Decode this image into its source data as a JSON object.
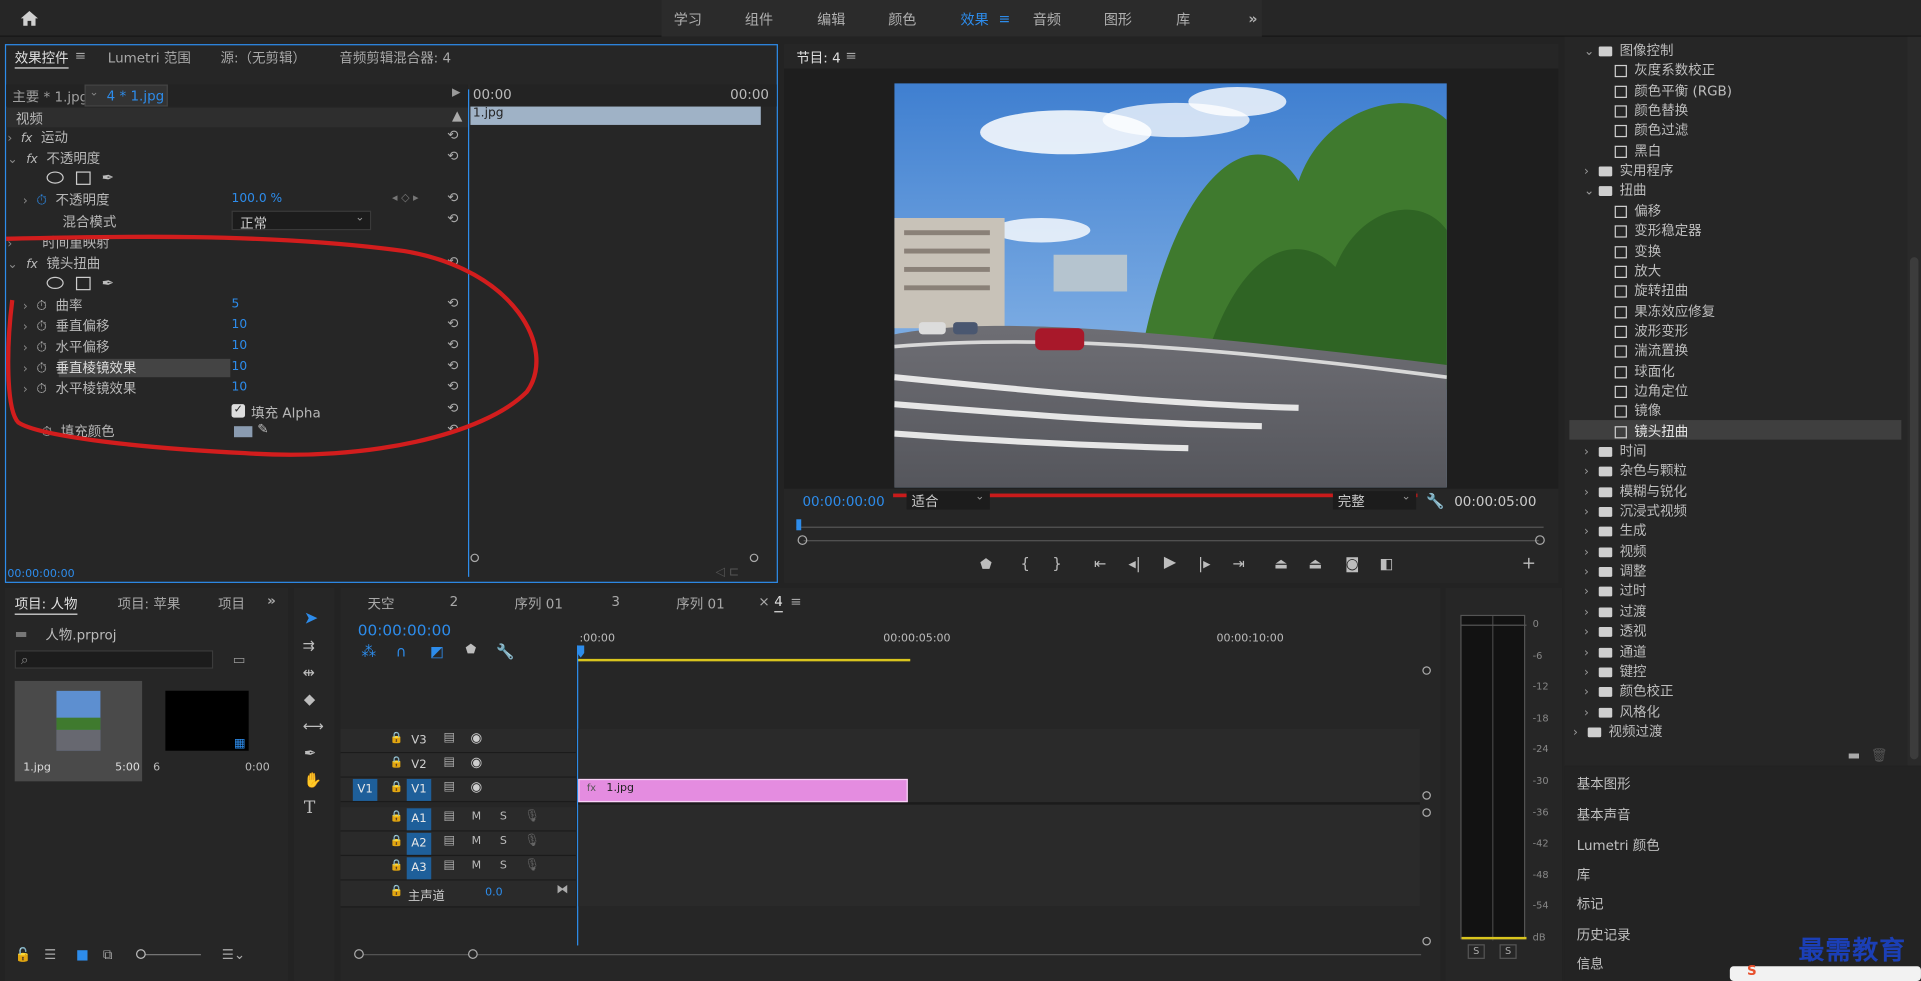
{
  "workspace": {
    "home": "home-icon",
    "tabs": [
      "学习",
      "组件",
      "编辑",
      "颜色",
      "效果",
      "音频",
      "图形",
      "库"
    ],
    "active": "效果",
    "more": "»"
  },
  "effect_controls": {
    "tabs": [
      "效果控件",
      "Lumetri 范围",
      "源:（无剪辑）",
      "音频剪辑混合器: 4"
    ],
    "master": "主要 * 1.jpg",
    "clip": "4 * 1.jpg",
    "time_start": "00:00",
    "time_end": "00:00",
    "clip_name": "1.jpg",
    "video_heading": "视频",
    "motion": "运动",
    "opacity": "不透明度",
    "opacity_prop": "不透明度",
    "opacity_value": "100.0 %",
    "blend_mode": "混合模式",
    "blend_value": "正常",
    "time_remap": "时间重映射",
    "lens_distortion": "镜头扭曲",
    "params": [
      {
        "label": "曲率",
        "value": "5"
      },
      {
        "label": "垂直偏移",
        "value": "10"
      },
      {
        "label": "水平偏移",
        "value": "10"
      },
      {
        "label": "垂直棱镜效果",
        "value": "10"
      },
      {
        "label": "水平棱镜效果",
        "value": "10"
      }
    ],
    "fill_alpha": "填充 Alpha",
    "fill_color": "填充颜色",
    "timecode": "00:00:00:00"
  },
  "program": {
    "title": "节目: 4",
    "timecode": "00:00:00:00",
    "fit": "适合",
    "quality": "完整",
    "duration": "00:00:05:00"
  },
  "effects_tree": [
    {
      "label": "图像控制",
      "type": "folder",
      "indent": 1,
      "open": true
    },
    {
      "label": "灰度系数校正",
      "type": "effect",
      "indent": 2
    },
    {
      "label": "颜色平衡 (RGB)",
      "type": "effect",
      "indent": 2
    },
    {
      "label": "颜色替换",
      "type": "effect",
      "indent": 2
    },
    {
      "label": "颜色过滤",
      "type": "effect",
      "indent": 2
    },
    {
      "label": "黑白",
      "type": "effect",
      "indent": 2
    },
    {
      "label": "实用程序",
      "type": "folder",
      "indent": 1,
      "open": false
    },
    {
      "label": "扭曲",
      "type": "folder",
      "indent": 1,
      "open": true
    },
    {
      "label": "偏移",
      "type": "effect",
      "indent": 2
    },
    {
      "label": "变形稳定器",
      "type": "effect",
      "indent": 2
    },
    {
      "label": "变换",
      "type": "effect",
      "indent": 2
    },
    {
      "label": "放大",
      "type": "effect",
      "indent": 2
    },
    {
      "label": "旋转扭曲",
      "type": "effect",
      "indent": 2
    },
    {
      "label": "果冻效应修复",
      "type": "effect",
      "indent": 2
    },
    {
      "label": "波形变形",
      "type": "effect",
      "indent": 2
    },
    {
      "label": "湍流置换",
      "type": "effect",
      "indent": 2
    },
    {
      "label": "球面化",
      "type": "effect",
      "indent": 2
    },
    {
      "label": "边角定位",
      "type": "effect",
      "indent": 2
    },
    {
      "label": "镜像",
      "type": "effect",
      "indent": 2
    },
    {
      "label": "镜头扭曲",
      "type": "effect",
      "indent": 2,
      "selected": true
    },
    {
      "label": "时间",
      "type": "folder",
      "indent": 1,
      "open": false
    },
    {
      "label": "杂色与颗粒",
      "type": "folder",
      "indent": 1,
      "open": false
    },
    {
      "label": "模糊与锐化",
      "type": "folder",
      "indent": 1,
      "open": false
    },
    {
      "label": "沉浸式视频",
      "type": "folder",
      "indent": 1,
      "open": false
    },
    {
      "label": "生成",
      "type": "folder",
      "indent": 1,
      "open": false
    },
    {
      "label": "视频",
      "type": "folder",
      "indent": 1,
      "open": false
    },
    {
      "label": "调整",
      "type": "folder",
      "indent": 1,
      "open": false
    },
    {
      "label": "过时",
      "type": "folder",
      "indent": 1,
      "open": false
    },
    {
      "label": "过渡",
      "type": "folder",
      "indent": 1,
      "open": false
    },
    {
      "label": "透视",
      "type": "folder",
      "indent": 1,
      "open": false
    },
    {
      "label": "通道",
      "type": "folder",
      "indent": 1,
      "open": false
    },
    {
      "label": "键控",
      "type": "folder",
      "indent": 1,
      "open": false
    },
    {
      "label": "颜色校正",
      "type": "folder",
      "indent": 1,
      "open": false
    },
    {
      "label": "风格化",
      "type": "folder",
      "indent": 1,
      "open": false
    },
    {
      "label": "视频过渡",
      "type": "folder",
      "indent": 0,
      "open": false
    }
  ],
  "side_panels": [
    "基本图形",
    "基本声音",
    "Lumetri 颜色",
    "库",
    "标记",
    "历史记录",
    "信息"
  ],
  "project": {
    "tabs": [
      "项目: 人物",
      "项目: 苹果",
      "项目"
    ],
    "file": "人物.prproj",
    "items": [
      {
        "name": "1.jpg",
        "duration": "5:00"
      },
      {
        "name": "6",
        "duration": "0:00"
      }
    ]
  },
  "timeline": {
    "tabs": [
      "天空",
      "2",
      "序列 01",
      "3",
      "序列 01",
      "4"
    ],
    "active": "4",
    "timecode": "00:00:00:00",
    "ruler": [
      ":00:00",
      "00:00:05:00",
      "00:00:10:00"
    ],
    "tracks": [
      "V3",
      "V2",
      "V1",
      "A1",
      "A2",
      "A3"
    ],
    "src": "V1",
    "master": "主声道",
    "master_value": "0.0",
    "clip": "1.jpg",
    "m": "M",
    "s": "S"
  },
  "meter": {
    "labels": [
      "0",
      "-6",
      "-12",
      "-18",
      "-24",
      "-30",
      "-36",
      "-42",
      "-48",
      "-54",
      "dB"
    ],
    "solo": [
      "S",
      "S"
    ]
  },
  "watermark": "最需教育"
}
